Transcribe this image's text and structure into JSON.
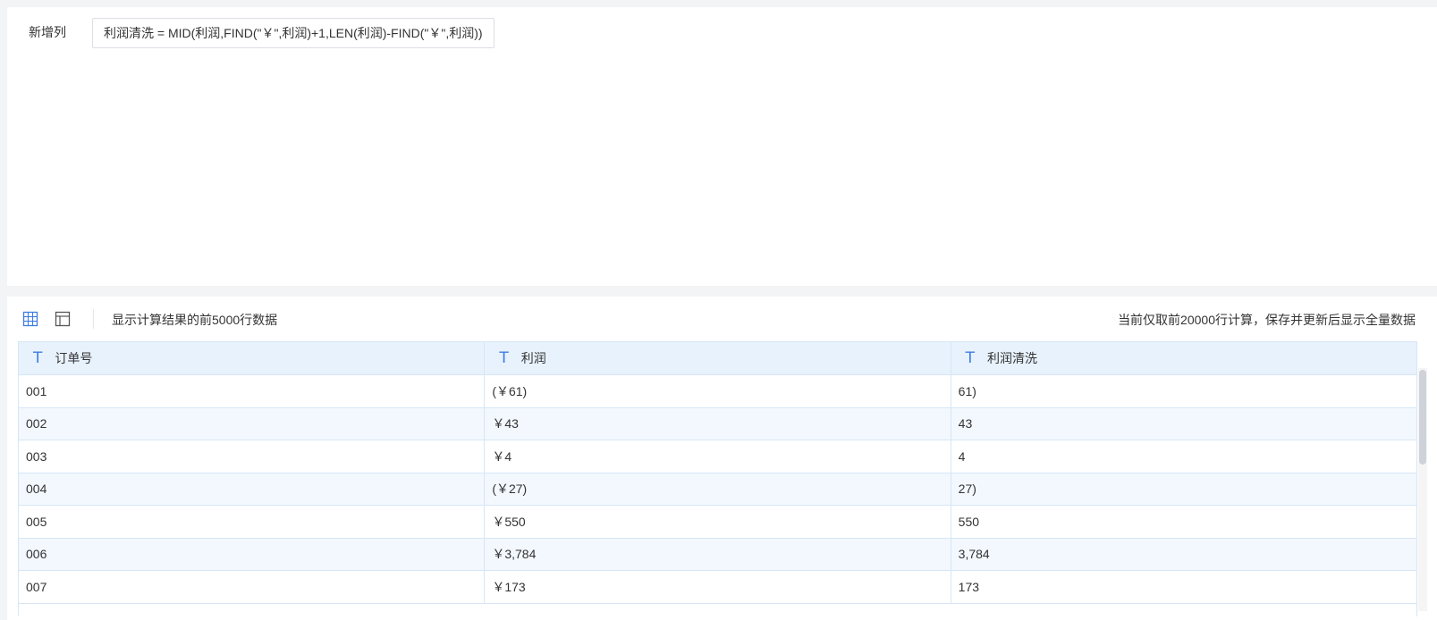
{
  "formula": {
    "label": "新增列",
    "expression": "利润清洗 = MID(利润,FIND(\"￥\",利润)+1,LEN(利润)-FIND(\"￥\",利润))"
  },
  "toolbar": {
    "table_view_icon": "grid-icon",
    "layout_view_icon": "layout-icon",
    "left_text": "显示计算结果的前5000行数据",
    "right_text": "当前仅取前20000行计算，保存并更新后显示全量数据"
  },
  "table": {
    "type_icon": "T",
    "columns": [
      "订单号",
      "利润",
      "利润清洗"
    ],
    "rows": [
      [
        "001",
        "(￥61)",
        "61)"
      ],
      [
        "002",
        "￥43",
        "43"
      ],
      [
        "003",
        "￥4",
        "4"
      ],
      [
        "004",
        "(￥27)",
        "27)"
      ],
      [
        "005",
        "￥550",
        "550"
      ],
      [
        "006",
        "￥3,784",
        "3,784"
      ],
      [
        "007",
        "￥173",
        "173"
      ]
    ]
  },
  "colors": {
    "accent": "#3e7ce4",
    "header_bg": "#e8f2fd",
    "border": "#d6e6f7"
  }
}
